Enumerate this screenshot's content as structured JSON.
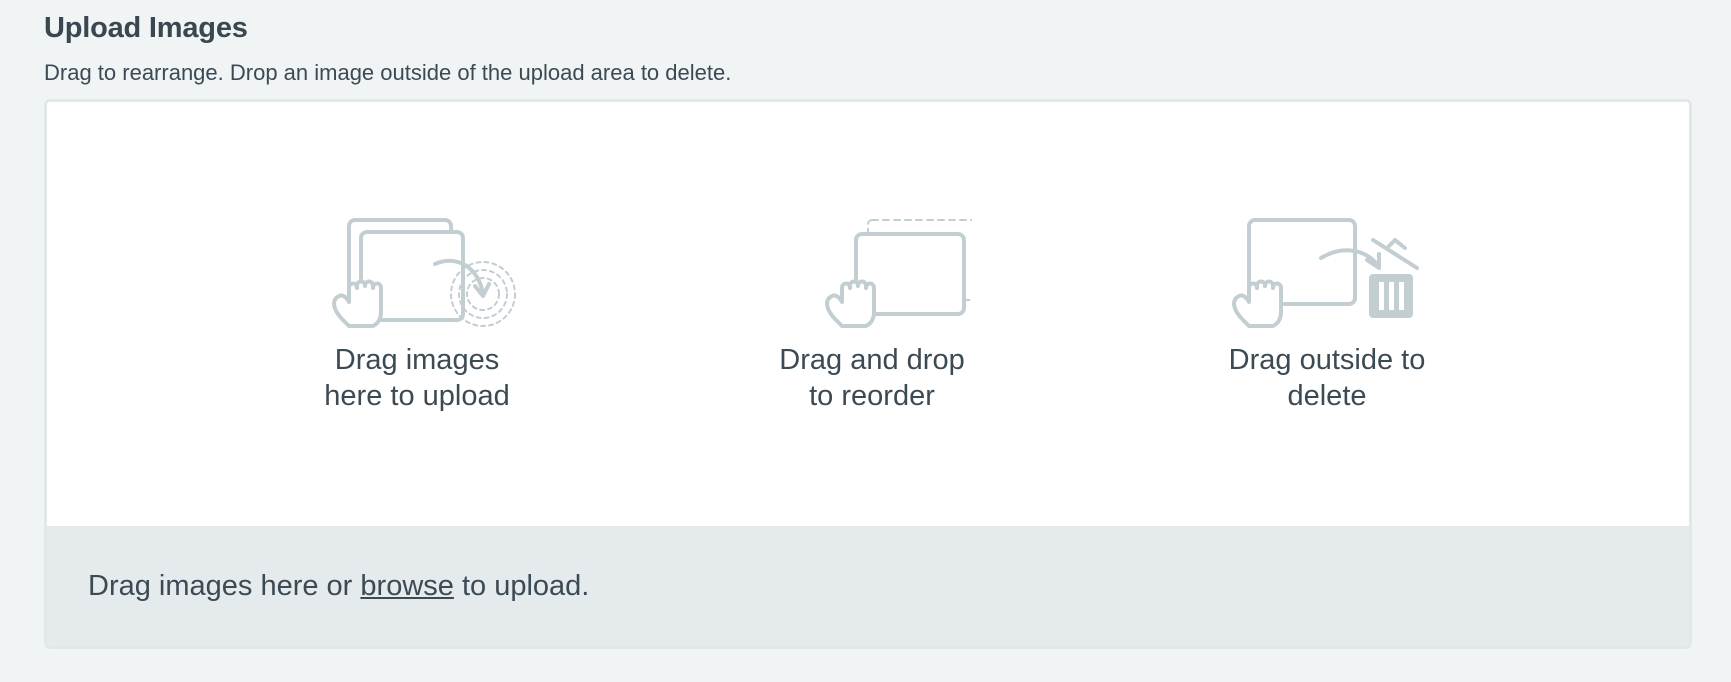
{
  "section": {
    "title": "Upload Images",
    "help_text": "Drag to rearrange. Drop an image outside of the upload area to delete."
  },
  "hints": [
    {
      "icon": "drag-upload-icon",
      "line1": "Drag images",
      "line2": "here to upload"
    },
    {
      "icon": "drag-reorder-icon",
      "line1": "Drag and drop",
      "line2": "to reorder"
    },
    {
      "icon": "drag-delete-icon",
      "line1": "Drag outside to",
      "line2": "delete"
    }
  ],
  "upload_bar": {
    "prefix": "Drag images here or ",
    "browse_label": "browse",
    "suffix": " to upload."
  },
  "colors": {
    "page_background": "#f0f4f5",
    "panel_background": "#ffffff",
    "bar_background": "#e5eaed",
    "icon_stroke": "#c2ced2",
    "text": "#3c4a54"
  }
}
